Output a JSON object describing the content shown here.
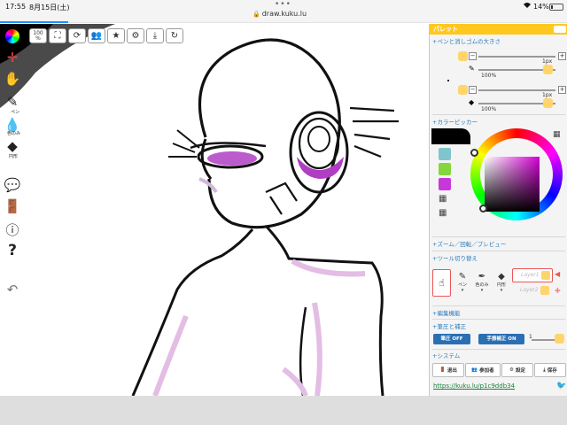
{
  "status_bar": {
    "time": "17:55",
    "date": "8月15日(土)",
    "url": "draw.kuku.lu",
    "battery": "14%",
    "battery_level": 0.14,
    "dots": "•••"
  },
  "top_toolbar": {
    "zoom_label": "100",
    "zoom_unit": "%"
  },
  "left_tools": [
    {
      "name": "pen",
      "label": "ペン"
    },
    {
      "name": "eyedropper",
      "label": "色のみ"
    },
    {
      "name": "shape",
      "label": "円形"
    }
  ],
  "panel": {
    "title": "パレット",
    "sections": {
      "pen_eraser_size": "+ペンと消しゴムの大きさ",
      "color_picker": "+カラーピッカー",
      "zoom_rotate": "+ズーム／回転／プレビュー",
      "tool_switch": "+ツール切り替え",
      "edit": "+編集機能",
      "pressure": "+筆圧と補正",
      "system": "+システム"
    },
    "pen": {
      "size": "1px",
      "opacity": "100%"
    },
    "eraser": {
      "size": "1px",
      "opacity": "100%"
    },
    "swatches": [
      {
        "color": "#7fc6cc"
      },
      {
        "color": "#83d63b"
      },
      {
        "color": "#c838d9"
      }
    ],
    "current_color": "#000000",
    "tools": [
      {
        "label": ""
      },
      {
        "label": "ペン"
      },
      {
        "label": "色のみ"
      },
      {
        "label": "円形"
      }
    ],
    "layers": [
      "Layer1",
      "Layer2"
    ],
    "pressure_off": "筆圧 OFF",
    "hand_correct_on": "手振補正 ON",
    "pressure_level": "1",
    "bottom_buttons": [
      {
        "label": "退出",
        "icon": "door-icon"
      },
      {
        "label": "参加者",
        "icon": "people-icon"
      },
      {
        "label": "設定",
        "icon": "gear-icon"
      },
      {
        "label": "保存",
        "icon": "download-icon"
      }
    ],
    "share_url": "https://kuku.lu/p1c9ddb34"
  },
  "colors": {
    "accent": "#ffc81e",
    "link": "#2b7bbd",
    "button_blue": "#2b6fb3"
  }
}
